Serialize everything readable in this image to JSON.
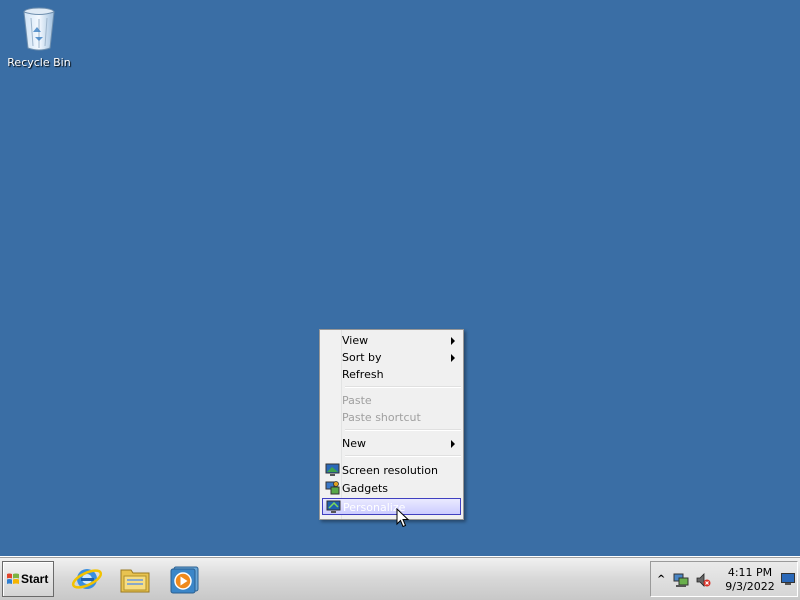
{
  "desktop": {
    "background_color": "#3a6ea5",
    "icons": [
      {
        "label": "Recycle Bin",
        "icon": "recycle-bin-icon"
      }
    ]
  },
  "context_menu": {
    "items": [
      {
        "label": "View",
        "submenu": true,
        "enabled": true
      },
      {
        "label": "Sort by",
        "submenu": true,
        "enabled": true
      },
      {
        "label": "Refresh",
        "submenu": false,
        "enabled": true
      },
      {
        "label": "Paste",
        "submenu": false,
        "enabled": false
      },
      {
        "label": "Paste shortcut",
        "submenu": false,
        "enabled": false
      },
      {
        "label": "New",
        "submenu": true,
        "enabled": true
      },
      {
        "label": "Screen resolution",
        "icon": "display-settings-icon",
        "enabled": true
      },
      {
        "label": "Gadgets",
        "icon": "gadgets-icon",
        "enabled": true
      },
      {
        "label": "Personalize",
        "icon": "personalize-icon",
        "enabled": true,
        "highlighted": true
      }
    ]
  },
  "taskbar": {
    "start_label": "Start",
    "pinned": [
      {
        "icon": "internet-explorer-icon"
      },
      {
        "icon": "file-explorer-icon"
      },
      {
        "icon": "media-player-icon"
      }
    ],
    "tray": {
      "icons": [
        "show-hidden-icons-chevron-icon",
        "network-icon",
        "volume-muted-icon"
      ],
      "clock": {
        "time": "4:11 PM",
        "date": "9/3/2022"
      }
    }
  }
}
